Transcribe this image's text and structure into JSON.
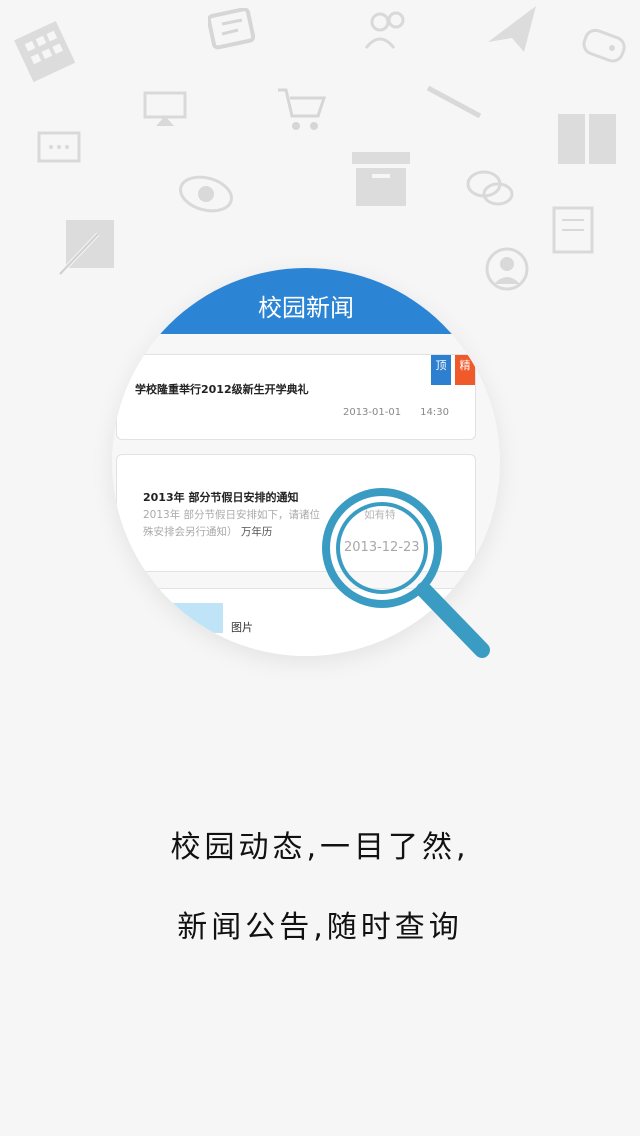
{
  "header": {
    "title": "校园新闻"
  },
  "tags": {
    "top": "顶",
    "fine": "精"
  },
  "news": [
    {
      "title": "学校隆重举行2012级新生开学典礼",
      "date": "2013-01-01",
      "time": "14:30"
    },
    {
      "title": "2013年 部分节假日安排的通知",
      "desc": "2013年 部分节假日安排如下，请诸位",
      "desc_tail": "如有特",
      "desc2": "殊安排会另行通知）",
      "desc2_tail": "万年历",
      "date": "2013-12-23"
    },
    {
      "title": "图片"
    }
  ],
  "captions": {
    "line1": "校园动态,一目了然,",
    "line2": "新闻公告,随时查询"
  },
  "colors": {
    "accent": "#2c84d4",
    "tag_top": "#2d7fcf",
    "tag_fine": "#f05a2a",
    "magnifier": "#3a9cc2"
  },
  "background_icons": [
    "building-icon",
    "chat-icon",
    "people-icon",
    "paper-plane-icon",
    "game-controller-icon",
    "monitor-icon",
    "shopping-cart-icon",
    "pen-icon",
    "message-icon",
    "box-icon",
    "book-icon",
    "eye-icon",
    "discussion-icon",
    "notebook-icon",
    "edit-icon",
    "user-icon"
  ]
}
